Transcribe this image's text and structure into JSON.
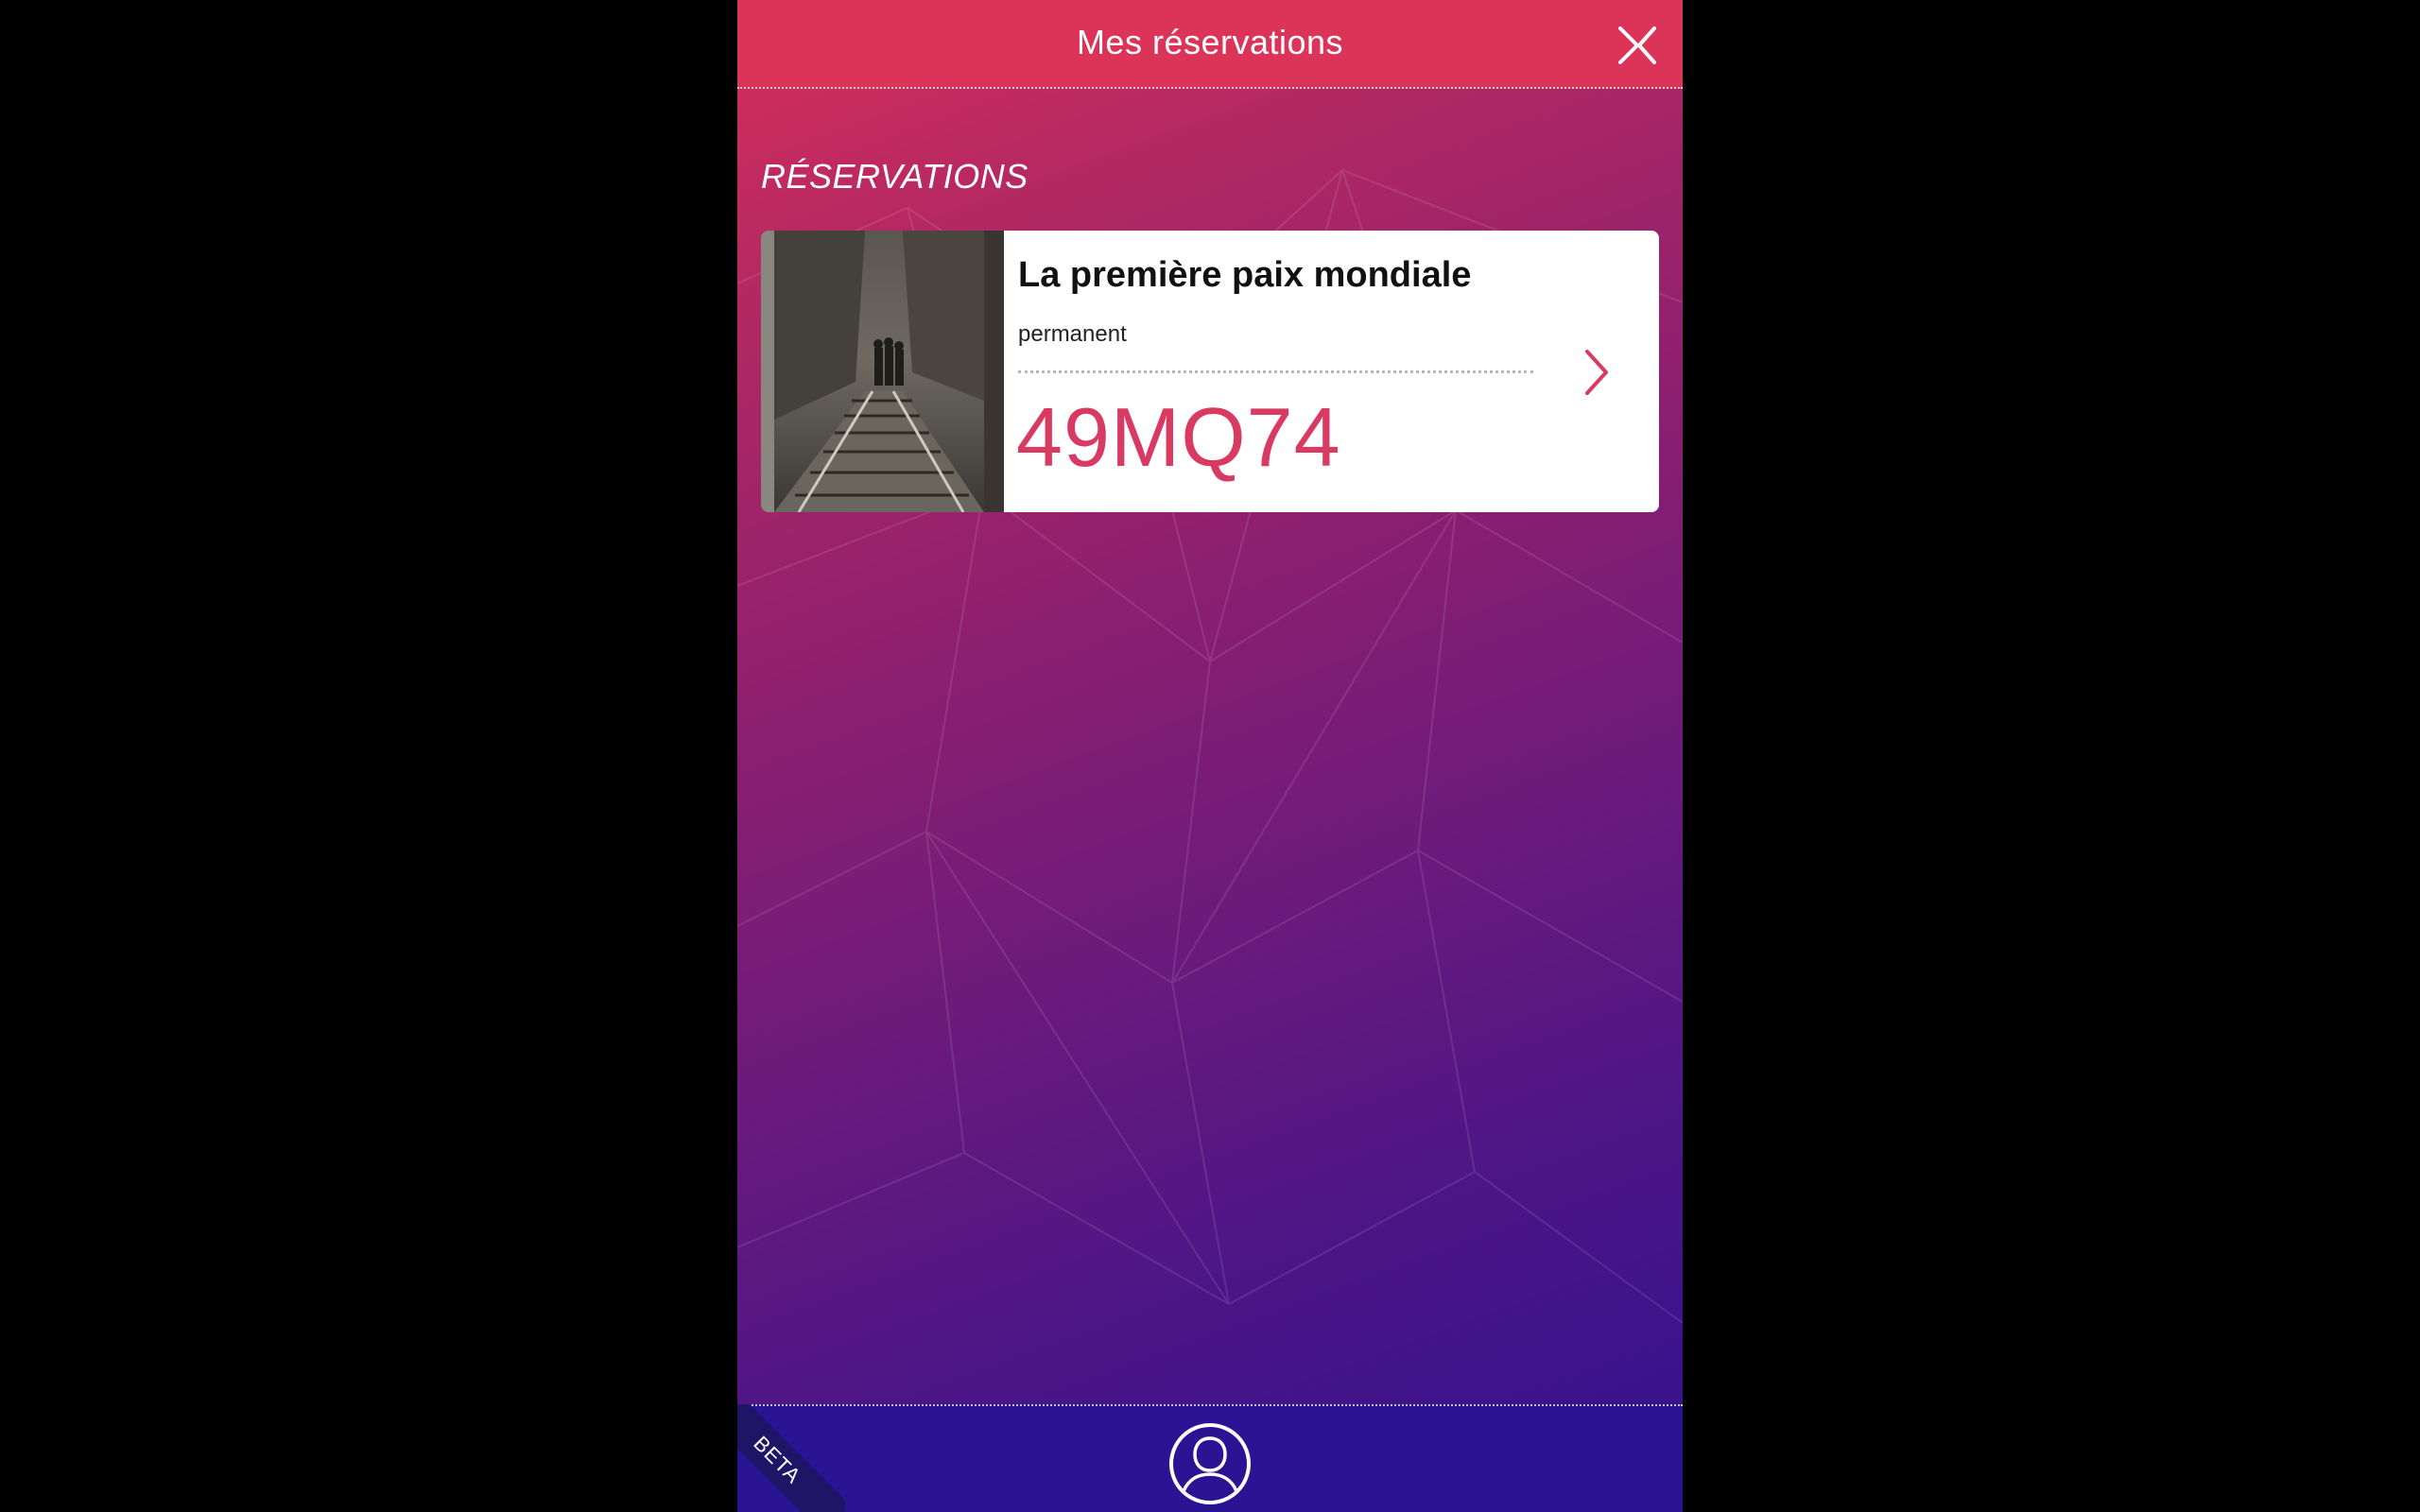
{
  "header": {
    "title": "Mes réservations",
    "close_icon": "close-icon"
  },
  "section": {
    "title": "RÉSERVATIONS"
  },
  "reservations": [
    {
      "title": "La première paix mondiale",
      "subtitle": "permanent",
      "code": "49MQ74",
      "thumbnail": "people-walking-on-railway-photo",
      "chevron_icon": "chevron-right-icon"
    }
  ],
  "footer": {
    "profile_icon": "user-profile-icon",
    "badge": "BETA"
  },
  "colors": {
    "header_bg": "#dc3359",
    "accent": "#d93a62",
    "footer_bg": "#2a1493",
    "gradient_top": "#d72e5a",
    "gradient_bottom": "#32118f"
  }
}
